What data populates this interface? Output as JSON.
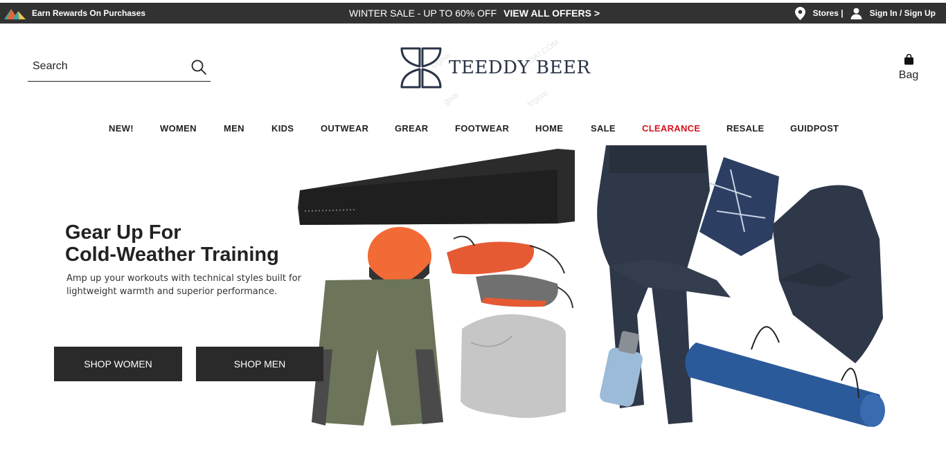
{
  "topbar": {
    "rewards": "Earn Rewards On Purchases",
    "sale": "WINTER SALE - UP TO 60% OFF",
    "offers": "VIEW ALL OFFERS >",
    "stores": "Stores |",
    "signin": "Sign In / Sign Up"
  },
  "header": {
    "search_placeholder": "Search",
    "logo_text": "TEEDDY BEER",
    "bag_label": "Bag",
    "watermark": [
      "logoai",
      "GOAI.COM",
      "goai",
      "logoai"
    ]
  },
  "nav": {
    "items": [
      "NEW!",
      "WOMEN",
      "MEN",
      "KIDS",
      "OUTWEAR",
      "GREAR",
      "FOOTWEAR",
      "HOME",
      "SALE",
      "CLEARANCE",
      "RESALE",
      "GUIDPOST"
    ]
  },
  "hero": {
    "title_line1": "Gear Up For",
    "title_line2": "Cold-Weather Training",
    "subtitle": "Amp up your workouts with technical styles built for lightweight warmth and superior performance.",
    "shop_women": "SHOP WOMEN",
    "shop_men": "SHOP MEN"
  },
  "colors": {
    "topbar_bg": "#323232",
    "button_bg": "#2a2a2a",
    "clearance_red": "#d6111a",
    "logo_navy": "#2a3447"
  },
  "icons": [
    "mountain-logo-icon",
    "location-pin-icon",
    "user-icon",
    "search-icon",
    "shopping-bag-icon",
    "teddy-beer-logo-icon"
  ]
}
